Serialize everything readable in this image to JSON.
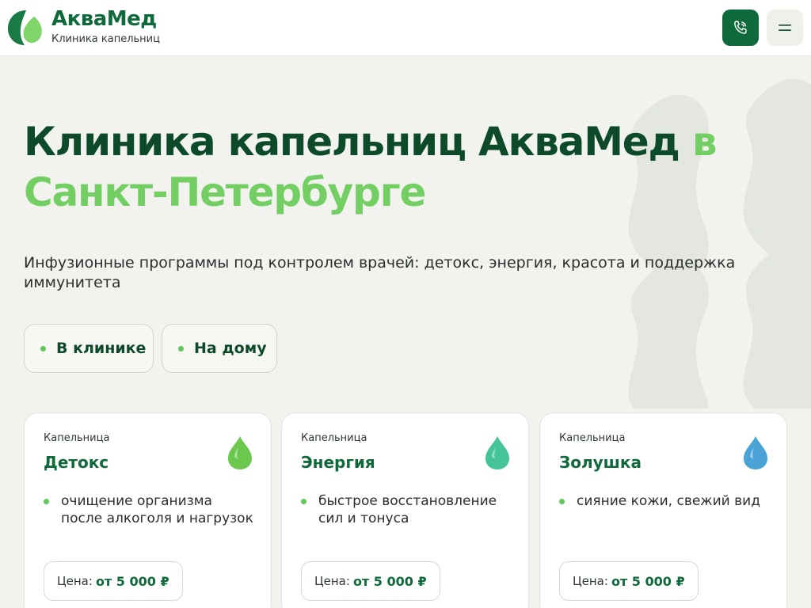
{
  "header": {
    "brand": "АкваМед",
    "tagline": "Клиника капельниц",
    "phone_icon": "phone-icon",
    "menu_icon": "menu-icon"
  },
  "hero": {
    "title_main": "Клиника капельниц АкваМед",
    "title_accent_inline": "в",
    "title_accent_line2": "Санкт-Петербурге",
    "subtitle": "Инфузионные программы под контролем врачей: детокс, энергия, красота и поддержка иммунитета"
  },
  "modes": [
    {
      "label": "В клинике"
    },
    {
      "label": "На дому"
    }
  ],
  "cards": [
    {
      "kind": "Капельница",
      "title": "Детокс",
      "icon": "drop-icon",
      "color": "#6cc84d",
      "bullet": "очищение организма после алкоголя и нагрузок",
      "price_label": "Цена:",
      "price_value": "от 5 000 ₽"
    },
    {
      "kind": "Капельница",
      "title": "Энергия",
      "icon": "drop-icon",
      "color": "#45c399",
      "bullet": "быстрое восстановление сил и тонуса",
      "price_label": "Цена:",
      "price_value": "от 5 000 ₽"
    },
    {
      "kind": "Капельница",
      "title": "Золушка",
      "icon": "drop-icon",
      "color": "#4aa3d6",
      "bullet": "сияние кожи, свежий вид",
      "price_label": "Цена:",
      "price_value": "от 5 000 ₽"
    }
  ],
  "colors": {
    "brand_green": "#0f6a3b",
    "accent_green": "#73cf63",
    "background": "#f2f3ee"
  }
}
